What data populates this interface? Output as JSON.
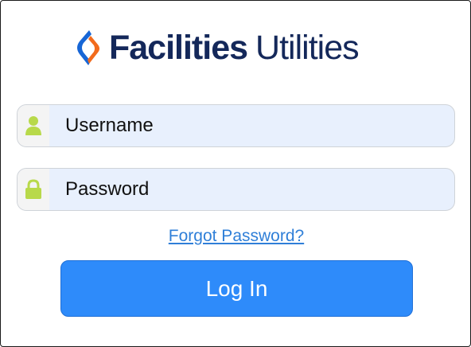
{
  "brand": {
    "name_primary": "Facilities",
    "name_secondary": "Utilities",
    "logo_icon": "flame-logo-icon",
    "colors": {
      "text": "#14285a",
      "mark_blue": "#1766d6",
      "mark_orange": "#f26b1d"
    }
  },
  "login_form": {
    "username": {
      "placeholder": "Username",
      "value": "",
      "icon": "user-icon"
    },
    "password": {
      "placeholder": "Password",
      "value": "",
      "icon": "lock-icon"
    },
    "forgot_password_label": "Forgot Password?",
    "submit_label": "Log In"
  },
  "colors": {
    "field_background": "#e8f0fd",
    "icon_color": "#b8d94a",
    "link": "#2f7fd8",
    "button": "#2e8bfa"
  }
}
